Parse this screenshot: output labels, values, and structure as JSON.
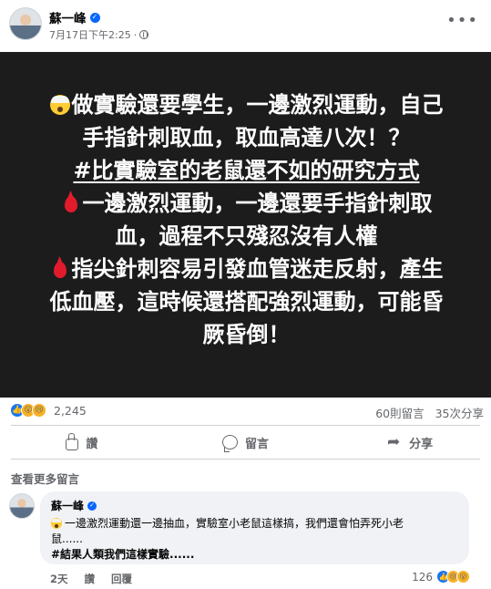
{
  "post": {
    "author": "蘇一峰",
    "timestamp": "7月17日下午2:25",
    "more_icon": "•••",
    "image_text": {
      "line1": "做實驗還要學生，一邊激烈運動，自己",
      "line2": "手指針刺取血，取血高達八次！？",
      "line3": "#比實驗室的老鼠還不如的研究方式",
      "line4": "一邊激烈運動，一邊還要手指針刺取",
      "line5": "血，過程不只殘忍沒有人權",
      "line6": "指尖針刺容易引發血管迷走反射，產生",
      "line7": "低血壓，這時候還搭配強烈運動，可能昏",
      "line8": "厥昏倒！"
    }
  },
  "stats": {
    "reaction_count": "2,245",
    "comments": "60則留言",
    "shares": "35次分享"
  },
  "actions": {
    "like": "讚",
    "comment": "留言",
    "share": "分享"
  },
  "see_more_comments": "查看更多留言",
  "comment": {
    "author": "蘇一峰",
    "text_line1": "一邊激烈運動還一邊抽血，實驗室小老鼠這樣搞，我們還會怕弄死小老",
    "text_line2": "鼠......",
    "hashtag": "#結果人類我們這樣實驗......",
    "age": "2天",
    "like": "讚",
    "reply": "回覆",
    "reaction_count": "126"
  },
  "colors": {
    "image_background": "#1c1c1c",
    "verified": "#0866ff",
    "like_blue": "#1877f2",
    "secondary_text": "#65676b"
  }
}
